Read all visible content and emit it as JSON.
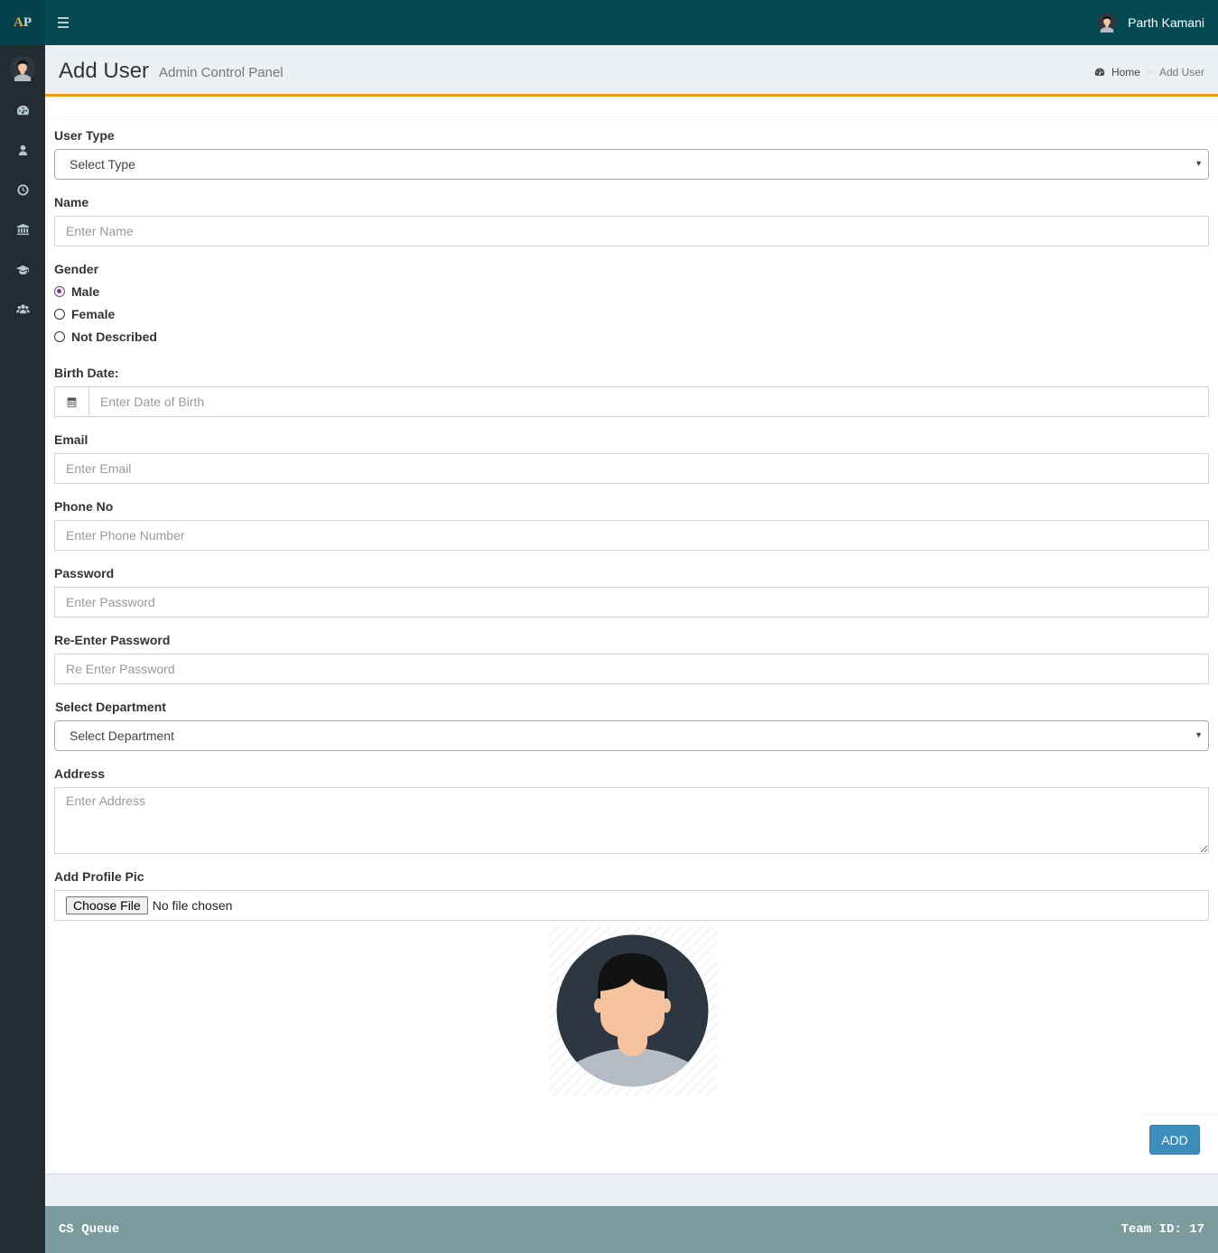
{
  "app": {
    "logo_a": "A",
    "logo_p": "P"
  },
  "header": {
    "user_name": "Parth Kamani"
  },
  "sidebar": {
    "icons": [
      "dashboard-icon",
      "user-icon",
      "clock-icon",
      "bank-icon",
      "graduation-cap-icon",
      "users-icon"
    ]
  },
  "page": {
    "title": "Add User",
    "subtitle": "Admin Control Panel"
  },
  "breadcrumb": {
    "home": "Home",
    "current": "Add User"
  },
  "form": {
    "user_type": {
      "label": "User Type",
      "value": "Select Type"
    },
    "name": {
      "label": "Name",
      "placeholder": "Enter Name"
    },
    "gender": {
      "label": "Gender",
      "options": [
        "Male",
        "Female",
        "Not Described"
      ],
      "selected": "Male"
    },
    "birth_date": {
      "label": "Birth Date:",
      "placeholder": "Enter Date of Birth"
    },
    "email": {
      "label": "Email",
      "placeholder": "Enter Email"
    },
    "phone": {
      "label": "Phone No",
      "placeholder": "Enter Phone Number"
    },
    "password": {
      "label": "Password",
      "placeholder": "Enter Password"
    },
    "re_password": {
      "label": "Re-Enter Password",
      "placeholder": "Re Enter Password"
    },
    "department": {
      "label": "Select Department",
      "value": "Select Department"
    },
    "address": {
      "label": "Address",
      "placeholder": "Enter Address"
    },
    "profile_pic": {
      "label": "Add Profile Pic",
      "button": "Choose File",
      "status": "No file chosen"
    },
    "submit": "ADD"
  },
  "footer": {
    "left": "CS Queue",
    "right": "Team ID: 17"
  }
}
